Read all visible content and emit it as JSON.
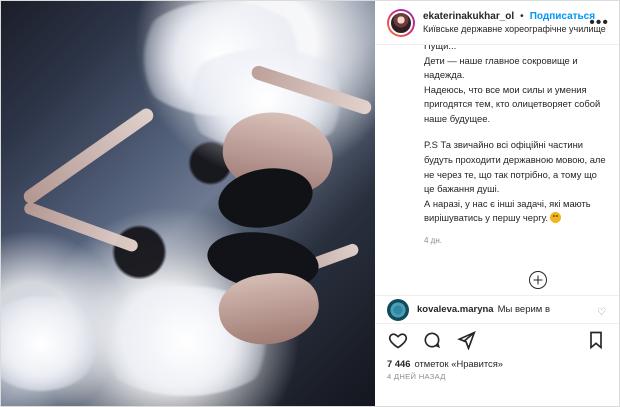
{
  "post": {
    "username": "ekaterinakukhar_ol",
    "follow_label": "Подписаться",
    "location": "Київське державне хореографічне училище",
    "more_label": "•••",
    "caption": {
      "cut_line": "Пущи...",
      "line1": "Дети — наше главное сокровище и надежда.",
      "line2": "Надеюсь, что все мои силы и умения пригодятся тем, кто олицетворяет собой наше будущее.",
      "line3": "P.S Та звичайно всі офіційні частини будуть проходити державною мовою, але не через те, що так потрібно, а тому що це бажання душі.",
      "line4": "А наразі, у нас є інші задачі, які мають вирішуватись у першу чергу."
    },
    "time_ago": "4 дн.",
    "comment": {
      "username": "kovaleva.maryna",
      "text": "Мы верим в"
    },
    "likes_count": "7 446",
    "likes_text": "отметок «Нравится»",
    "date_text": "4 ДНЕЙ НАЗАД"
  },
  "icons": {
    "more": "more-icon",
    "load": "plus-circle-icon",
    "heart": "heart-icon",
    "comment": "comment-icon",
    "share": "share-icon",
    "bookmark": "bookmark-icon"
  }
}
